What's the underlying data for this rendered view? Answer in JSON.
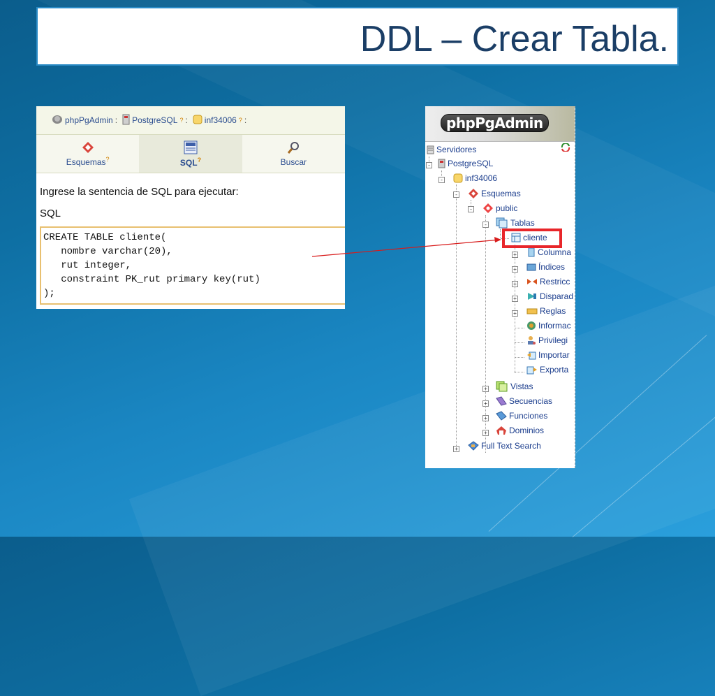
{
  "slide": {
    "title": "DDL – Crear Tabla."
  },
  "sql_panel": {
    "breadcrumb": [
      {
        "label": "phpPgAdmin",
        "icon": "elephant-icon"
      },
      {
        "label": "PostgreSQL",
        "icon": "server-icon",
        "help": "?"
      },
      {
        "label": "inf34006",
        "icon": "database-icon",
        "help": "?"
      }
    ],
    "tabs": [
      {
        "label": "Esquemas",
        "help": "?",
        "icon": "schema-icon",
        "active": false
      },
      {
        "label": "SQL",
        "help": "?",
        "icon": "sql-icon",
        "active": true
      },
      {
        "label": "Buscar",
        "icon": "magnifier-icon",
        "active": false
      }
    ],
    "prompt": "Ingrese la sentencia de SQL para ejecutar:",
    "sql_label": "SQL",
    "sql_text": "CREATE TABLE cliente(\n   nombre varchar(20),\n   rut integer,\n   constraint PK_rut primary key(rut)\n);"
  },
  "tree_panel": {
    "logo": "phpPgAdmin",
    "nodes": {
      "servidores": "Servidores",
      "postgresql": "PostgreSQL",
      "db": "inf34006",
      "esquemas": "Esquemas",
      "public": "public",
      "tablas": "Tablas",
      "cliente": "cliente",
      "columnas": "Columna",
      "indices": "Índices",
      "restricciones": "Restricc",
      "disparadores": "Disparad",
      "reglas": "Reglas",
      "informacion": "Informac",
      "privilegios": "Privilegi",
      "importar": "Importar",
      "exportar": "Exporta",
      "vistas": "Vistas",
      "secuencias": "Secuencias",
      "funciones": "Funciones",
      "dominios": "Dominios",
      "fulltext": "Full Text Search"
    }
  },
  "colors": {
    "title": "#1b3e66",
    "highlight": "#e8262a",
    "link": "#1a3c8c"
  }
}
